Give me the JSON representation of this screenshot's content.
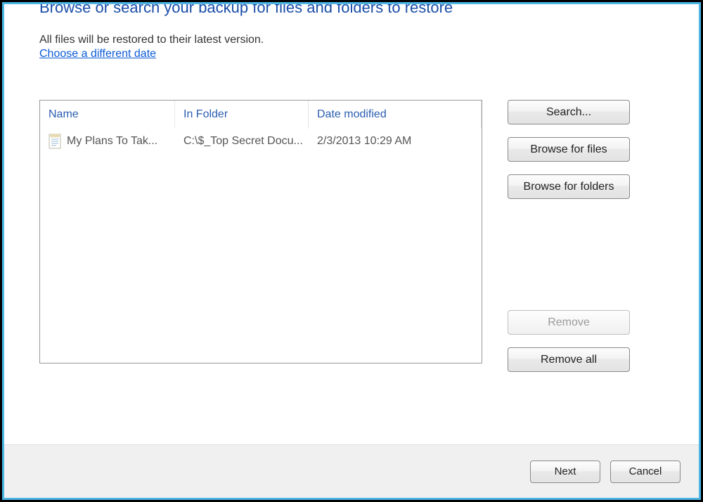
{
  "header": {
    "title": "Browse or search your backup for files and folders to restore",
    "description": "All files will be restored to their latest version.",
    "link_text": "Choose a different date"
  },
  "list": {
    "columns": {
      "name": "Name",
      "folder": "In Folder",
      "date": "Date modified"
    },
    "rows": [
      {
        "name": "My Plans To Tak...",
        "folder": "C:\\$_Top Secret Docu...",
        "date": "2/3/2013 10:29 AM"
      }
    ]
  },
  "buttons": {
    "search": "Search...",
    "browse_files": "Browse for files",
    "browse_folders": "Browse for folders",
    "remove": "Remove",
    "remove_all": "Remove all",
    "next": "Next",
    "cancel": "Cancel"
  }
}
